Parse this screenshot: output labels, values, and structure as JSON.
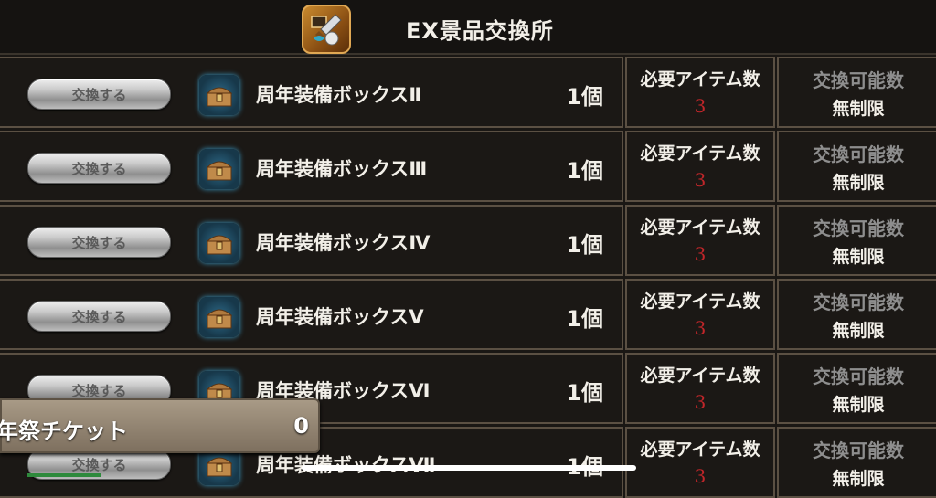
{
  "header": {
    "title": "EX景品交換所",
    "icon": "exchange-shop-icon"
  },
  "columns": {
    "required_label": "必要アイテム数",
    "limit_label": "交換可能数"
  },
  "rows": [
    {
      "button": "交換する",
      "name": "周年装備ボックスⅡ",
      "qty": "1個",
      "required": "3",
      "limit": "無制限"
    },
    {
      "button": "交換する",
      "name": "周年装備ボックスⅢ",
      "qty": "1個",
      "required": "3",
      "limit": "無制限"
    },
    {
      "button": "交換する",
      "name": "周年装備ボックスⅣ",
      "qty": "1個",
      "required": "3",
      "limit": "無制限"
    },
    {
      "button": "交換する",
      "name": "周年装備ボックスⅤ",
      "qty": "1個",
      "required": "3",
      "limit": "無制限"
    },
    {
      "button": "交換する",
      "name": "周年装備ボックスⅥ",
      "qty": "1個",
      "required": "3",
      "limit": "無制限"
    },
    {
      "button": "交換する",
      "name": "周年装備ボックスⅦ",
      "qty": "1個",
      "required": "3",
      "limit": "無制限"
    }
  ],
  "ticket": {
    "label": "年祭チケット",
    "count": "0"
  },
  "colors": {
    "background": "#1b1815",
    "border": "#5b5043",
    "required_value": "#c1262a",
    "limit_label": "#8e8e8e"
  }
}
